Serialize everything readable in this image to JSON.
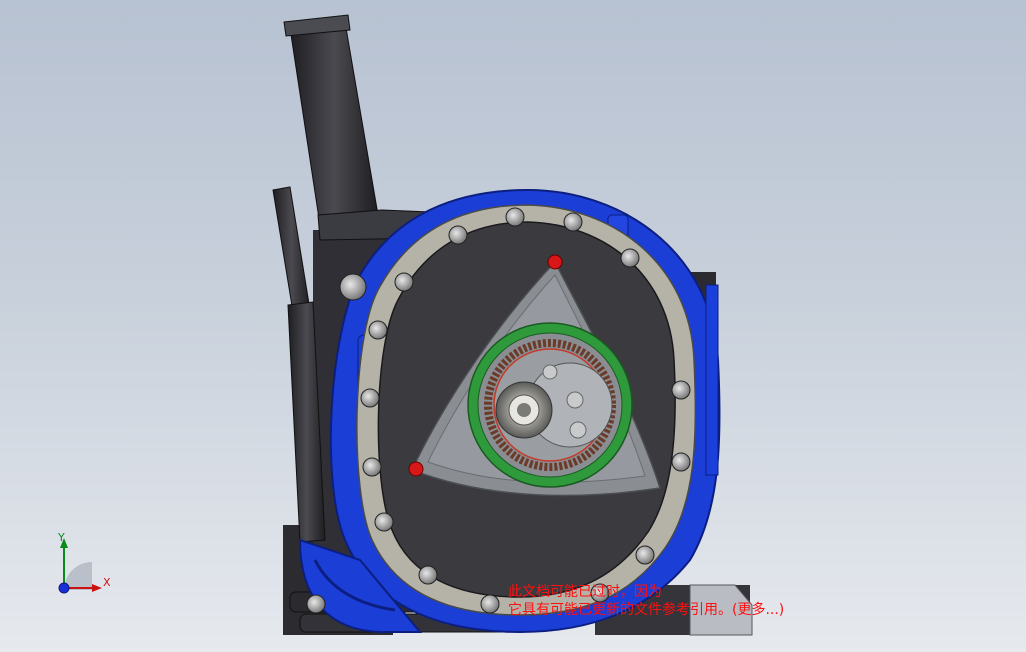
{
  "viewport": {
    "background_colors": [
      "#b7c2d2",
      "#e6e9ee"
    ],
    "model_colors": {
      "housing_blue": "#1a3ed6",
      "housing_dark": "#2d2d32",
      "rotor_gray": "#8a8d92",
      "ring_gear_green": "#2f9a3c",
      "seal_red": "#d81818",
      "liner_silver": "#b5b2a8"
    }
  },
  "triad": {
    "x_label": "X",
    "y_label": "Y"
  },
  "warning": {
    "line1": "此文档可能已过时，因为",
    "line2_text": "它具有可能已更新的文件参考引用。",
    "more_link": "(更多...)"
  }
}
